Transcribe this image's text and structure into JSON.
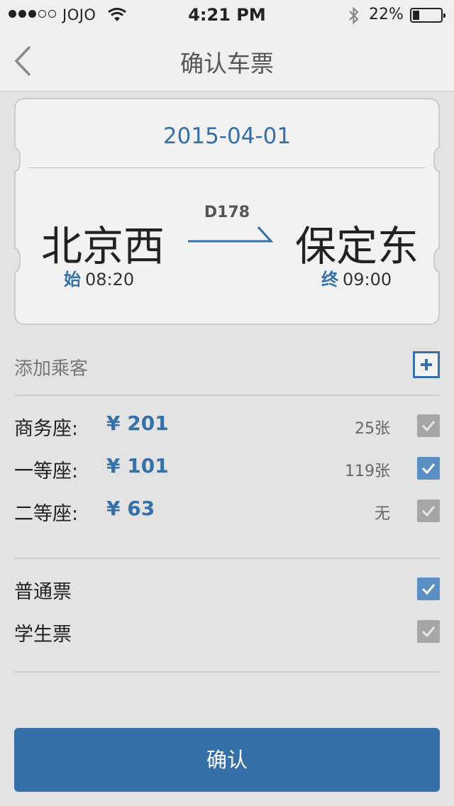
{
  "status_bar": {
    "carrier": "JOJO",
    "time": "4:21 PM",
    "battery": "22%",
    "signal_bars_filled": 3,
    "signal_bars_total": 5
  },
  "nav": {
    "title": "确认车票",
    "back_icon": "chevron-left-icon"
  },
  "ticket": {
    "date": "2015-04-01",
    "train_number": "D178",
    "from_station": "北京西",
    "to_station": "保定东",
    "depart_tag": "始",
    "depart_time": "08:20",
    "arrive_tag": "终",
    "arrive_time": "09:00"
  },
  "passengers": {
    "add_label": "添加乘客",
    "add_icon": "plus-icon"
  },
  "seats": [
    {
      "name": "商务座:",
      "price": "¥ 201",
      "count": "25张",
      "checked": false
    },
    {
      "name": "一等座:",
      "price": "¥ 101",
      "count": "119张",
      "checked": true
    },
    {
      "name": "二等座:",
      "price": "¥ 63",
      "count": "无",
      "checked": false
    }
  ],
  "ticket_types": [
    {
      "name": "普通票",
      "checked": true
    },
    {
      "name": "学生票",
      "checked": false
    }
  ],
  "confirm_label": "确认",
  "colors": {
    "accent": "#3570a8",
    "checkbox_on": "#5b8fc4",
    "checkbox_off": "#a6a6a6",
    "background": "#e3e3e3"
  }
}
